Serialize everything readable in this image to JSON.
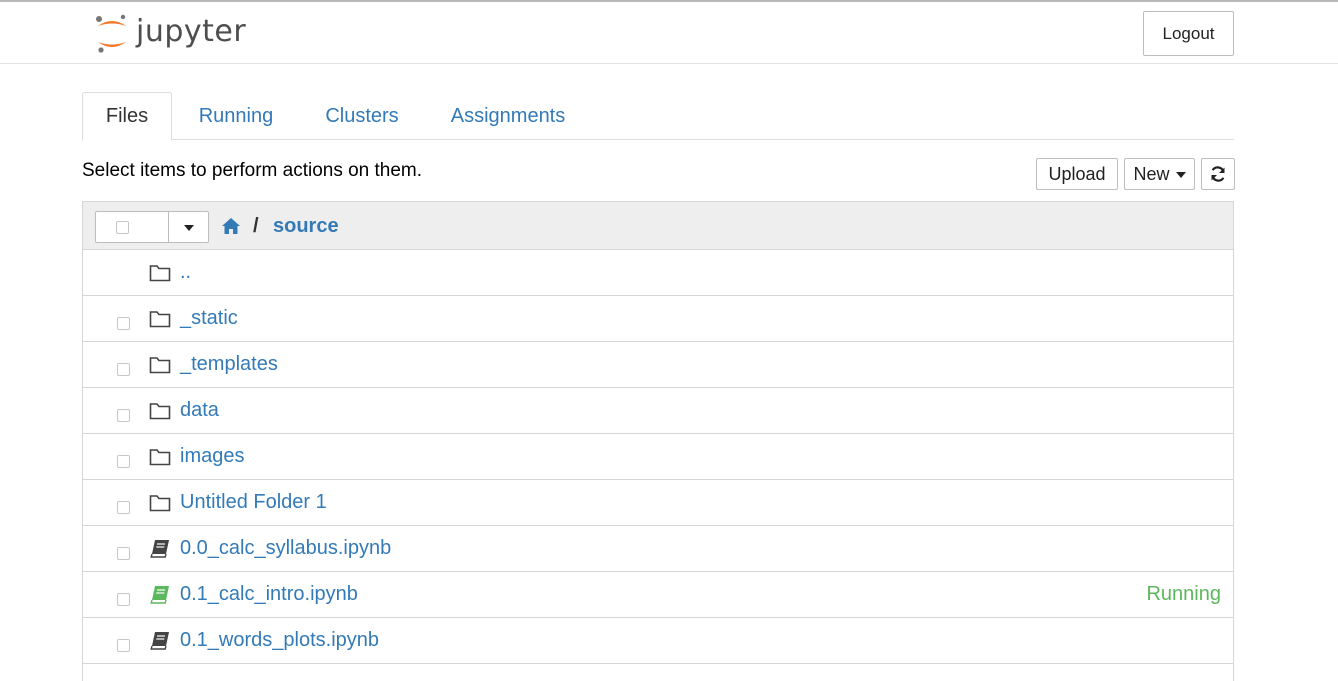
{
  "header": {
    "logo_text": "jupyter",
    "logout_label": "Logout"
  },
  "tabs": [
    {
      "label": "Files",
      "active": true
    },
    {
      "label": "Running",
      "active": false
    },
    {
      "label": "Clusters",
      "active": false
    },
    {
      "label": "Assignments",
      "active": false
    }
  ],
  "toolbar": {
    "hint": "Select items to perform actions on them.",
    "upload_label": "Upload",
    "new_label": "New",
    "refresh_icon": "refresh-icon"
  },
  "breadcrumb": {
    "home_icon": "home-icon",
    "separator": "/",
    "current": "source"
  },
  "files": [
    {
      "name": "..",
      "type": "folder",
      "checkbox": false,
      "status": ""
    },
    {
      "name": "_static",
      "type": "folder",
      "checkbox": true,
      "status": ""
    },
    {
      "name": "_templates",
      "type": "folder",
      "checkbox": true,
      "status": ""
    },
    {
      "name": "data",
      "type": "folder",
      "checkbox": true,
      "status": ""
    },
    {
      "name": "images",
      "type": "folder",
      "checkbox": true,
      "status": ""
    },
    {
      "name": "Untitled Folder 1",
      "type": "folder",
      "checkbox": true,
      "status": ""
    },
    {
      "name": "0.0_calc_syllabus.ipynb",
      "type": "notebook",
      "checkbox": true,
      "status": ""
    },
    {
      "name": "0.1_calc_intro.ipynb",
      "type": "notebook-running",
      "checkbox": true,
      "status": "Running"
    },
    {
      "name": "0.1_words_plots.ipynb",
      "type": "notebook",
      "checkbox": true,
      "status": ""
    }
  ],
  "colors": {
    "link": "#337ab7",
    "running": "#5cb85c",
    "logo_orange": "#f37726"
  }
}
